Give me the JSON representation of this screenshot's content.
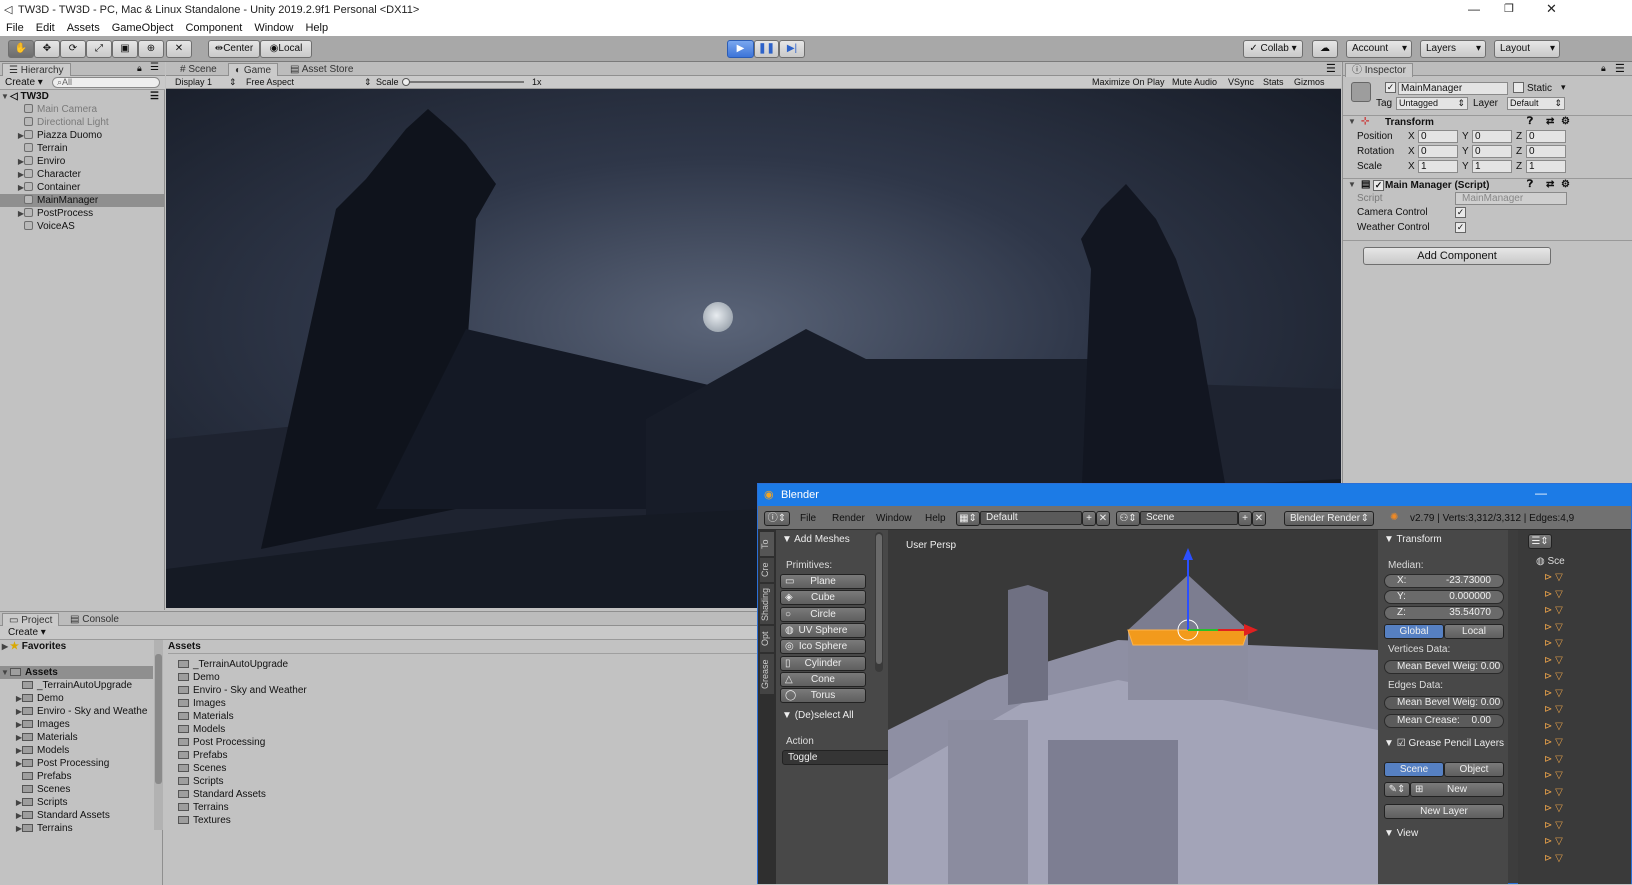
{
  "window": {
    "title": "TW3D - TW3D - PC, Mac & Linux Standalone - Unity 2019.2.9f1 Personal <DX11>"
  },
  "menu": [
    "File",
    "Edit",
    "Assets",
    "GameObject",
    "Component",
    "Window",
    "Help"
  ],
  "toolbar": {
    "center": "Center",
    "local": "Local",
    "collab": "Collab",
    "account": "Account",
    "layers": "Layers",
    "layout": "Layout"
  },
  "hierarchy": {
    "tab": "Hierarchy",
    "create": "Create",
    "search_placeholder": "All",
    "scene": "TW3D",
    "items": [
      {
        "name": "Main Camera",
        "dim": true,
        "expand": false
      },
      {
        "name": "Directional Light",
        "dim": true,
        "expand": false
      },
      {
        "name": "Piazza Duomo",
        "dim": false,
        "expand": true
      },
      {
        "name": "Terrain",
        "dim": false,
        "expand": false
      },
      {
        "name": "Enviro",
        "dim": false,
        "expand": true
      },
      {
        "name": "Character",
        "dim": false,
        "expand": true
      },
      {
        "name": "Container",
        "dim": false,
        "expand": true
      },
      {
        "name": "MainManager",
        "dim": false,
        "expand": false
      },
      {
        "name": "PostProcess",
        "dim": false,
        "expand": true
      },
      {
        "name": "VoiceAS",
        "dim": false,
        "expand": false
      }
    ]
  },
  "center_tabs": {
    "scene": "Scene",
    "game": "Game",
    "asset_store": "Asset Store"
  },
  "game_bar": {
    "display": "Display 1",
    "aspect": "Free Aspect",
    "scale_label": "Scale",
    "scale_value": "1x",
    "maximize": "Maximize On Play",
    "mute": "Mute Audio",
    "vsync": "VSync",
    "stats": "Stats",
    "gizmos": "Gizmos"
  },
  "inspector": {
    "tab": "Inspector",
    "object_name": "MainManager",
    "static": "Static",
    "tag_label": "Tag",
    "tag_value": "Untagged",
    "layer_label": "Layer",
    "layer_value": "Default",
    "transform": {
      "title": "Transform",
      "position": "Position",
      "rotation": "Rotation",
      "scale": "Scale",
      "x": "X",
      "y": "Y",
      "z": "Z",
      "pos": [
        "0",
        "0",
        "0"
      ],
      "rot": [
        "0",
        "0",
        "0"
      ],
      "scl": [
        "1",
        "1",
        "1"
      ]
    },
    "script": {
      "title": "Main Manager (Script)",
      "script_label": "Script",
      "script_value": "MainManager",
      "camera": "Camera Control",
      "weather": "Weather Control"
    },
    "add_component": "Add Component"
  },
  "project": {
    "tab_project": "Project",
    "tab_console": "Console",
    "create": "Create",
    "favorites": "Favorites",
    "assets": "Assets",
    "tree": [
      "_TerrainAutoUpgrade",
      "Demo",
      "Enviro - Sky and Weathe",
      "Images",
      "Materials",
      "Models",
      "Post Processing",
      "Prefabs",
      "Scenes",
      "Scripts",
      "Standard Assets",
      "Terrains"
    ],
    "tree_expand": [
      false,
      true,
      true,
      true,
      true,
      true,
      true,
      false,
      false,
      true,
      true,
      true
    ],
    "list_header": "Assets",
    "list": [
      "_TerrainAutoUpgrade",
      "Demo",
      "Enviro - Sky and Weather",
      "Images",
      "Materials",
      "Models",
      "Post Processing",
      "Prefabs",
      "Scenes",
      "Scripts",
      "Standard Assets",
      "Terrains",
      "Textures"
    ]
  },
  "blender": {
    "title": "Blender",
    "menu": [
      "File",
      "Render",
      "Window",
      "Help"
    ],
    "screen_layout": "Default",
    "scene": "Scene",
    "engine": "Blender Render",
    "stats": "v2.79 | Verts:3,312/3,312 | Edges:4,9",
    "tool_tabs": [
      "To",
      "Cre",
      "Shading",
      "Opt",
      "Grease"
    ],
    "add_meshes": "Add Meshes",
    "primitives": "Primitives:",
    "meshes": [
      "Plane",
      "Cube",
      "Circle",
      "UV Sphere",
      "Ico Sphere",
      "Cylinder",
      "Cone",
      "Torus"
    ],
    "deselect": "(De)select All",
    "action": "Action",
    "action_value": "Toggle",
    "viewport_label": "User Persp",
    "props": {
      "transform": "Transform",
      "median": "Median:",
      "x": "X:",
      "x_val": "-23.73000",
      "y": "Y:",
      "y_val": "0.000000",
      "z": "Z:",
      "z_val": "35.54070",
      "global": "Global",
      "local": "Local",
      "vertices": "Vertices Data:",
      "bevel_v": "Mean Bevel Weig: 0.00",
      "edges": "Edges Data:",
      "bevel_e": "Mean Bevel Weig: 0.00",
      "crease": "Mean Crease:",
      "crease_val": "0.00",
      "grease": "Grease Pencil Layers",
      "scene_btn": "Scene",
      "object_btn": "Object",
      "new": "New",
      "new_layer": "New Layer",
      "view": "View"
    },
    "outliner_label": "Sce"
  }
}
